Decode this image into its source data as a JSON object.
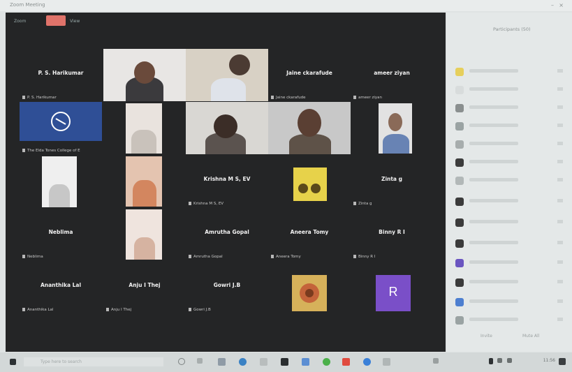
{
  "window": {
    "title": "Zoom Meeting"
  },
  "toolbar": {
    "left_label": "Zoom",
    "view_label": "View"
  },
  "tiles": {
    "t1": {
      "name": "P. S. Harikumar",
      "caption": "P. S. Harikumar"
    },
    "t2": {
      "name": "",
      "caption": ""
    },
    "t3": {
      "name": "",
      "caption": ""
    },
    "t4": {
      "name": "Jaine ckarafude",
      "caption": "Jaine ckarafude"
    },
    "t5": {
      "name": "ameer ziyan",
      "caption": "ameer ziyan"
    },
    "t6": {
      "name": "",
      "caption": "The Elda Tones College of E"
    },
    "t7": {
      "name": "",
      "caption": ""
    },
    "t8": {
      "name": "",
      "caption": ""
    },
    "t9": {
      "name": "",
      "caption": ""
    },
    "t10": {
      "name": "",
      "caption": ""
    },
    "t11": {
      "name": "",
      "caption": ""
    },
    "t12": {
      "name": "",
      "caption": ""
    },
    "t13": {
      "name": "Krishna M S, EV",
      "caption": "Krishna M S, EV"
    },
    "t14": {
      "name": "",
      "caption": ""
    },
    "t15": {
      "name": "Zinta g",
      "caption": "Zinta g"
    },
    "t16": {
      "name": "Neblima",
      "caption": "Neblima"
    },
    "t17": {
      "name": "",
      "caption": ""
    },
    "t18": {
      "name": "Amrutha Gopal",
      "caption": "Amrutha Gopal"
    },
    "t19": {
      "name": "Aneera Tomy",
      "caption": "Aneera Tomy"
    },
    "t20": {
      "name": "Binny R I",
      "caption": "Binny R I"
    },
    "t21": {
      "name": "Ananthika Lal",
      "caption": "Ananthika Lal"
    },
    "t22": {
      "name": "Anju I Thej",
      "caption": "Anju I Thej"
    },
    "t23": {
      "name": "Gowri J.B",
      "caption": "Gowri J.B"
    },
    "t24": {
      "name": "",
      "caption": ""
    },
    "t25": {
      "name": "",
      "caption": "",
      "initial": "R"
    }
  },
  "panel": {
    "title": "Participants (50)",
    "foot_left": "Invite",
    "foot_right": "Mute All"
  },
  "taskbar": {
    "search_placeholder": "Type here to search",
    "time": "11:56"
  },
  "colors": {
    "meeting_bg": "#242526",
    "avatar_purple": "#7a4fc8",
    "shared_blue": "#2f4f96",
    "record_red": "#e0736a"
  }
}
